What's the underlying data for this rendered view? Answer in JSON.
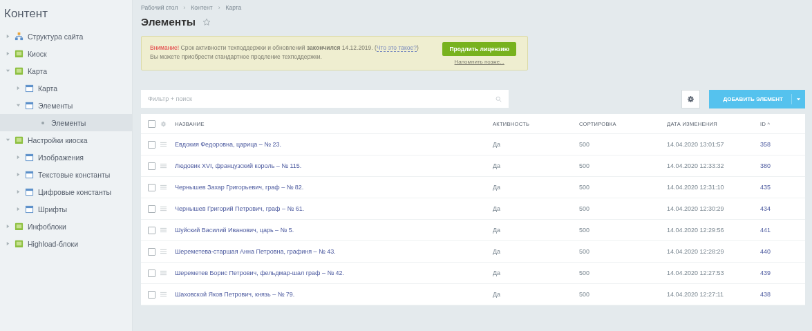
{
  "sidebar": {
    "title": "Контент",
    "items": [
      {
        "label": "Структура сайта",
        "kind": "structure",
        "expanded": false,
        "selected": false
      },
      {
        "label": "Киоск",
        "kind": "module",
        "expanded": false,
        "selected": false
      },
      {
        "label": "Карта",
        "kind": "module",
        "expanded": true,
        "selected": false,
        "children": [
          {
            "label": "Карта",
            "kind": "iblock",
            "expanded": false,
            "selected": false
          },
          {
            "label": "Элементы",
            "kind": "iblock",
            "expanded": true,
            "selected": false,
            "children": [
              {
                "label": "Элементы",
                "kind": "leaf",
                "selected": true
              }
            ]
          }
        ]
      },
      {
        "label": "Настройки киоска",
        "kind": "module",
        "expanded": true,
        "selected": false,
        "children": [
          {
            "label": "Изображения",
            "kind": "iblock",
            "expanded": false,
            "selected": false
          },
          {
            "label": "Текстовые константы",
            "kind": "iblock",
            "expanded": false,
            "selected": false
          },
          {
            "label": "Цифровые константы",
            "kind": "iblock",
            "expanded": false,
            "selected": false
          },
          {
            "label": "Шрифты",
            "kind": "iblock",
            "expanded": false,
            "selected": false
          }
        ]
      },
      {
        "label": "Инфоблоки",
        "kind": "module",
        "expanded": false,
        "selected": false
      },
      {
        "label": "Highload-блоки",
        "kind": "module",
        "expanded": false,
        "selected": false
      }
    ]
  },
  "breadcrumbs": [
    "Рабочий стол",
    "Контент",
    "Карта"
  ],
  "breadcrumb_separator": "›",
  "page_title": "Элементы",
  "favorite": false,
  "banner": {
    "warning_label": "Внимание!",
    "message": "Срок активности техподдержки и обновлений **закончился** 14.12.2019. (",
    "link": "Что это такое?",
    "message_end": ")",
    "line2": "Вы можете приобрести стандартное продление техподдержки.",
    "button": "Продлить лицензию",
    "remind_link": "Напомнить позже..."
  },
  "search": {
    "placeholder": "Фильтр + поиск"
  },
  "add_button": "ДОБАВИТЬ ЭЛЕМЕНТ",
  "table": {
    "header_checked": false,
    "columns": [
      "НАЗВАНИЕ",
      "АКТИВНОСТЬ",
      "СОРТИРОВКА",
      "ДАТА ИЗМЕНЕНИЯ",
      "ID ^"
    ],
    "rows": [
      {
        "checked": false,
        "name": "Евдокия Федоровна, царица – № 23.",
        "active": "Да",
        "sort": "500",
        "date": "14.04.2020 13:01:57",
        "id": "358"
      },
      {
        "checked": false,
        "name": "Людовик XVI, французский король – № 115.",
        "active": "Да",
        "sort": "500",
        "date": "14.04.2020 12:33:32",
        "id": "380"
      },
      {
        "checked": false,
        "name": "Чернышев Захар Григорьевич, граф – № 82.",
        "active": "Да",
        "sort": "500",
        "date": "14.04.2020 12:31:10",
        "id": "435"
      },
      {
        "checked": false,
        "name": "Чернышев Григорий Петрович, граф – № 61.",
        "active": "Да",
        "sort": "500",
        "date": "14.04.2020 12:30:29",
        "id": "434"
      },
      {
        "checked": false,
        "name": "Шуйский Василий Иванович, царь – № 5.",
        "active": "Да",
        "sort": "500",
        "date": "14.04.2020 12:29:56",
        "id": "441"
      },
      {
        "checked": false,
        "name": "Шереметева-старшая Анна Петровна, графиня – № 43.",
        "active": "Да",
        "sort": "500",
        "date": "14.04.2020 12:28:29",
        "id": "440"
      },
      {
        "checked": false,
        "name": "Шереметев Борис Петрович, фельдмар-шал граф – № 42.",
        "active": "Да",
        "sort": "500",
        "date": "14.04.2020 12:27:53",
        "id": "439"
      },
      {
        "checked": false,
        "name": "Шаховской Яков Петрович, князь – № 79.",
        "active": "Да",
        "sort": "500",
        "date": "14.04.2020 12:27:11",
        "id": "438"
      }
    ]
  }
}
